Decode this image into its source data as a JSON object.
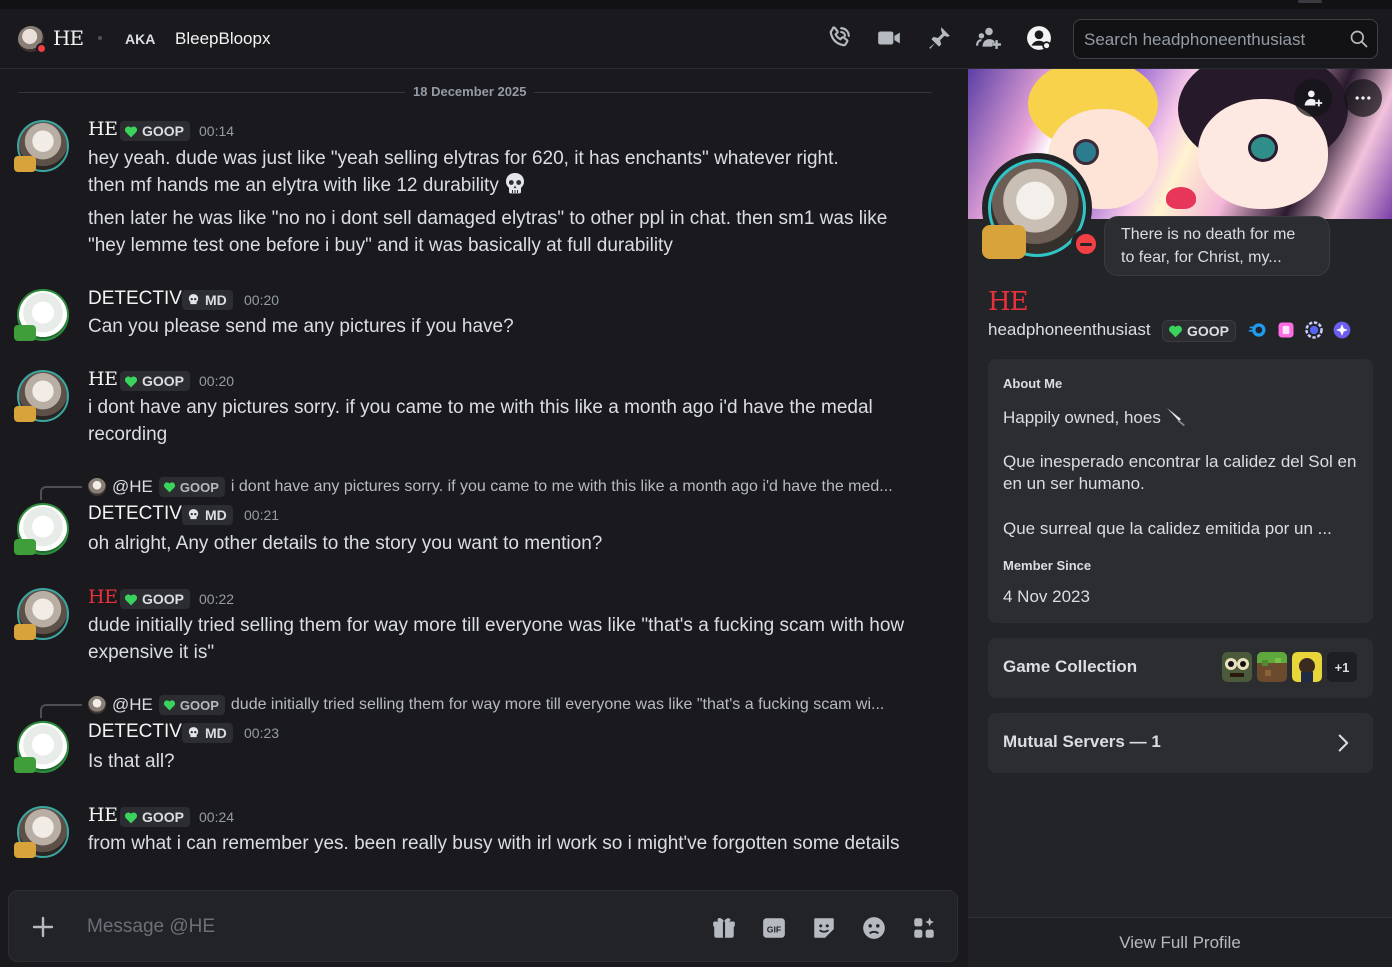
{
  "header": {
    "display_name": "HE",
    "aka_label": "AKA",
    "alias": "BleepBloopx",
    "search_placeholder": "Search headphoneenthusiast"
  },
  "chat": {
    "date_divider": "18 December 2025",
    "tags": {
      "goop": "GOOP",
      "md": "MD"
    },
    "messages": [
      {
        "author": "HE",
        "time": "00:14",
        "lines": [
          "hey yeah. dude was just like \"yeah selling elytras for 620, it has enchants\" whatever right.",
          "then mf hands me an elytra with like 12 durability",
          "then later he was like \"no no i dont sell damaged elytras\" to other ppl in chat. then sm1 was like \"hey lemme test one before i buy\" and it was basically at full durability"
        ]
      },
      {
        "author": "DETECTIV",
        "time": "00:20",
        "text": "Can you please send me any pictures if you have?"
      },
      {
        "author": "HE",
        "time": "00:20",
        "text": "i dont have any pictures sorry. if you came to me with this like a month ago i'd have the medal recording"
      },
      {
        "reply_name": "@HE",
        "reply_text": "i dont have any pictures sorry. if you came to me with this like a month ago i'd have the med...",
        "author": "DETECTIV",
        "time": "00:21",
        "text": "oh alright, Any other details to the story you want to mention?"
      },
      {
        "author": "HE",
        "time": "00:22",
        "text": "dude initially tried selling them for way more till everyone was like \"that's a fucking scam with how expensive it is\""
      },
      {
        "reply_name": "@HE",
        "reply_text": "dude initially tried selling them for way more till everyone was like \"that's a fucking scam wi...",
        "author": "DETECTIV",
        "time": "00:23",
        "text": "Is that all?"
      },
      {
        "author": "HE",
        "time": "00:24",
        "text": "from what i can remember yes. been really busy with irl work so i might've forgotten some details"
      }
    ],
    "composer_placeholder": "Message @HE"
  },
  "profile": {
    "status_bubble": "There is no death for me to fear, for Christ, my...",
    "display_name": "HE",
    "username": "headphoneenthusiast",
    "tag": "GOOP",
    "about_heading": "About Me",
    "about_line1": "Happily owned, hoes",
    "about_line2": "Que inesperado encontrar la calidez del Sol en en un ser humano.",
    "about_line3": "Que surreal que la calidez emitida por un ...",
    "member_since_heading": "Member Since",
    "member_since": "4 Nov 2023",
    "game_collection": "Game Collection",
    "game_more": "+1",
    "mutual_servers": "Mutual Servers — 1",
    "view_full_profile": "View Full Profile"
  },
  "colors": {
    "background": "#1a1a1e",
    "panel": "#232428",
    "card": "#2b2d31",
    "accent_red": "#e8313a",
    "dnd": "#f23f43",
    "text": "#dbdee1",
    "muted": "#949ba4"
  },
  "icons": [
    "phone-icon",
    "video-icon",
    "pin-icon",
    "add-friend-icon",
    "profile-toggle-icon",
    "search-icon",
    "plus-icon",
    "gift-icon",
    "gif-icon",
    "sticker-icon",
    "emoji-icon",
    "apps-icon",
    "chevron-right-icon",
    "more-icon",
    "skull-emoji",
    "knife-emoji",
    "heart-icon"
  ]
}
